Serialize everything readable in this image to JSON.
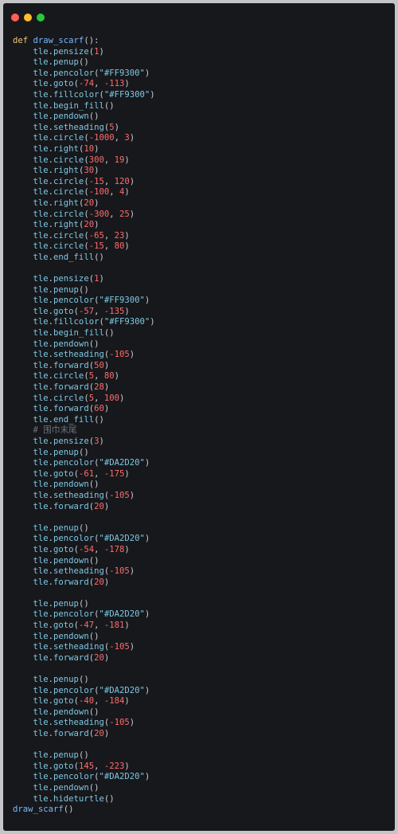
{
  "window": {
    "controls": [
      "close",
      "minimize",
      "maximize"
    ],
    "colors": {
      "close": "#ff5f57",
      "minimize": "#febc2e",
      "maximize": "#28c840"
    }
  },
  "code": {
    "language": "python",
    "lines": [
      "def draw_scarf():",
      "    tle.pensize(1)",
      "    tle.penup()",
      "    tle.pencolor(\"#FF9300\")",
      "    tle.goto(-74, -113)",
      "    tle.fillcolor(\"#FF9300\")",
      "    tle.begin_fill()",
      "    tle.pendown()",
      "    tle.setheading(5)",
      "    tle.circle(-1000, 3)",
      "    tle.right(10)",
      "    tle.circle(300, 19)",
      "    tle.right(30)",
      "    tle.circle(-15, 120)",
      "    tle.circle(-100, 4)",
      "    tle.right(20)",
      "    tle.circle(-300, 25)",
      "    tle.right(20)",
      "    tle.circle(-65, 23)",
      "    tle.circle(-15, 80)",
      "    tle.end_fill()",
      "",
      "    tle.pensize(1)",
      "    tle.penup()",
      "    tle.pencolor(\"#FF9300\")",
      "    tle.goto(-57, -135)",
      "    tle.fillcolor(\"#FF9300\")",
      "    tle.begin_fill()",
      "    tle.pendown()",
      "    tle.setheading(-105)",
      "    tle.forward(50)",
      "    tle.circle(5, 80)",
      "    tle.forward(28)",
      "    tle.circle(5, 100)",
      "    tle.forward(60)",
      "    tle.end_fill()",
      "    # 围巾末尾",
      "    tle.pensize(3)",
      "    tle.penup()",
      "    tle.pencolor(\"#DA2D20\")",
      "    tle.goto(-61, -175)",
      "    tle.pendown()",
      "    tle.setheading(-105)",
      "    tle.forward(20)",
      "",
      "    tle.penup()",
      "    tle.pencolor(\"#DA2D20\")",
      "    tle.goto(-54, -178)",
      "    tle.pendown()",
      "    tle.setheading(-105)",
      "    tle.forward(20)",
      "",
      "    tle.penup()",
      "    tle.pencolor(\"#DA2D20\")",
      "    tle.goto(-47, -181)",
      "    tle.pendown()",
      "    tle.setheading(-105)",
      "    tle.forward(20)",
      "",
      "    tle.penup()",
      "    tle.pencolor(\"#DA2D20\")",
      "    tle.goto(-40, -184)",
      "    tle.pendown()",
      "    tle.setheading(-105)",
      "    tle.forward(20)",
      "",
      "    tle.penup()",
      "    tle.goto(145, -223)",
      "    tle.pencolor(\"#DA2D20\")",
      "    tle.pendown()",
      "    tle.hideturtle()",
      "draw_scarf()"
    ]
  }
}
